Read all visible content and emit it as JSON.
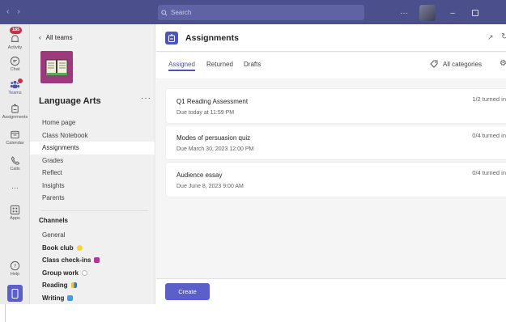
{
  "topbar": {
    "search_placeholder": "Search",
    "more": "···",
    "minimize": "–"
  },
  "rail": {
    "items": [
      {
        "label": "Activity",
        "badge": "185"
      },
      {
        "label": "Chat"
      },
      {
        "label": "Teams"
      },
      {
        "label": "Assignments"
      },
      {
        "label": "Calendar"
      },
      {
        "label": "Calls"
      },
      {
        "label": "···"
      },
      {
        "label": "Apps"
      },
      {
        "label": "Help"
      }
    ]
  },
  "team": {
    "back_label": "All teams",
    "name": "Language Arts",
    "more": "···",
    "nav": [
      "Home page",
      "Class Notebook",
      "Assignments",
      "Grades",
      "Reflect",
      "Insights",
      "Parents"
    ],
    "active_nav": "Assignments",
    "channels_heading": "Channels",
    "channels": [
      {
        "name": "General",
        "bold": false,
        "emoji_color": ""
      },
      {
        "name": "Book club",
        "bold": true,
        "emoji_color": "#f7d33e"
      },
      {
        "name": "Class check-ins",
        "bold": true,
        "emoji_color": "#b23a8e"
      },
      {
        "name": "Group work",
        "bold": true,
        "emoji_color": "#ffffff"
      },
      {
        "name": "Reading",
        "bold": true,
        "emoji_color": "#2f7ad1"
      },
      {
        "name": "Writing",
        "bold": true,
        "emoji_color": "#3aa0e8"
      }
    ]
  },
  "main": {
    "title": "Assignments",
    "tabs": [
      "Assigned",
      "Returned",
      "Drafts"
    ],
    "active_tab": "Assigned",
    "categories_label": "All categories",
    "assignments": [
      {
        "title": "Q1 Reading Assessment",
        "due": "Due today at 11:59 PM",
        "turned_in": "1/2 turned in"
      },
      {
        "title": "Modes of persuasion quiz",
        "due": "Due March 30, 2023 12:00 PM",
        "turned_in": "0/4 turned in"
      },
      {
        "title": "Audience essay",
        "due": "Due June 8, 2023 9:00 AM",
        "turned_in": "0/4 turned in"
      }
    ],
    "create_label": "Create"
  },
  "colors": {
    "topbar": "#4b4f8c",
    "accent": "#5b5fc7",
    "team_logo": "#9c3a7d",
    "badge": "#c4314b"
  }
}
